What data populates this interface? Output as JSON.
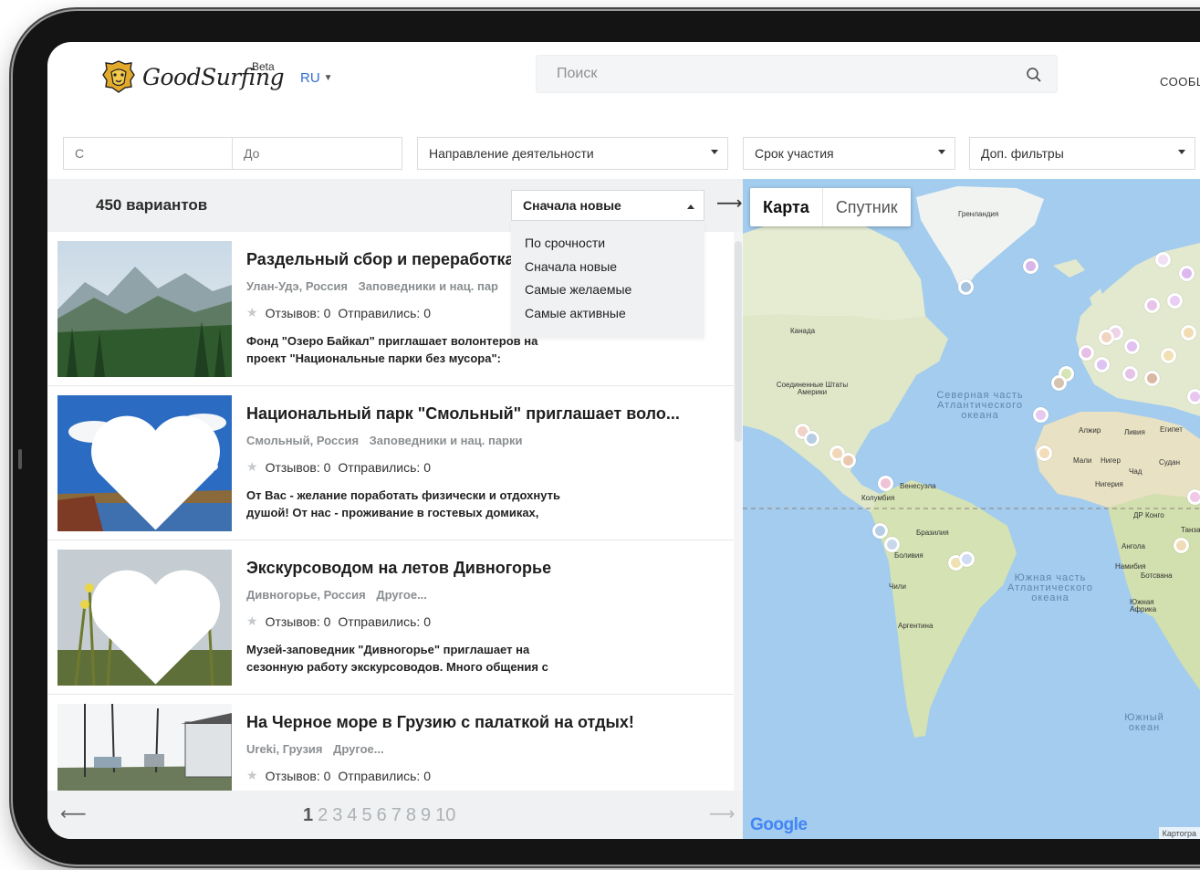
{
  "header": {
    "logo_text": "GoodSurfing",
    "beta_label": "Beta",
    "language": "RU",
    "search_placeholder": "Поиск",
    "nav_messages": "СООБЩ"
  },
  "filters": {
    "from_placeholder": "С",
    "to_placeholder": "До",
    "activity": "Направление деятельности",
    "duration": "Срок участия",
    "extra": "Доп. фильтры"
  },
  "list": {
    "count": "450 вариантов",
    "sort_current": "Сначала новые",
    "collapse_arrow": "⟶",
    "sort_options": [
      "По срочности",
      "Сначала новые",
      "Самые желаемые",
      "Самые активные"
    ],
    "cards": [
      {
        "title": "Раздельный сбор и переработка",
        "place": "Улан-Удэ, Россия",
        "category": "Заповедники и нац. пар",
        "stats": "Отзывов: 0",
        "went": "Отправились: 0",
        "desc": "Фонд \"Озеро Байкал\" приглашает волонтеров на проект \"Национальные парки без мусора\":"
      },
      {
        "title": "Национальный парк \"Смольный\" приглашает воло...",
        "place": "Смольный, Россия",
        "category": "Заповедники и нац. парки",
        "stats": "Отзывов: 0",
        "went": "Отправились: 0",
        "desc": "От Вас - желание поработать физически и отдохнуть душой! От нас - проживание в гостевых домиках,"
      },
      {
        "title": "Экскурсоводом на летов Дивногорье",
        "place": "Дивногорье, Россия",
        "category": "Другое...",
        "stats": "Отзывов: 0",
        "went": "Отправились: 0",
        "desc": "Музей-заповедник \"Дивногорье\" приглашает на сезонную работу экскурсоводов. Много общения с"
      },
      {
        "title": "На Черное море в Грузию с палаткой на отдых!",
        "place": "Ureki, Грузия",
        "category": "Другое...",
        "stats": "Отзывов: 0",
        "went": "Отправились: 0",
        "desc": ""
      }
    ]
  },
  "pager": {
    "prev": "⟵",
    "next": "⟶",
    "pages": [
      "1",
      "2",
      "3",
      "4",
      "5",
      "6",
      "7",
      "8",
      "9",
      "10"
    ],
    "active_page": "1"
  },
  "map": {
    "tab_map": "Карта",
    "tab_satellite": "Спутник",
    "labels": {
      "greenland": "Гренландия",
      "canada": "Канада",
      "usa": "Соединенные Штаты Америки",
      "north_atlantic": "Северная часть Атлантического океана",
      "south_atlantic": "Южная часть Атлантического океана",
      "southern_ocean": "Южный океан",
      "brazil": "Бразилия",
      "bolivia": "Боливия",
      "chile": "Чили",
      "argentina": "Аргентина",
      "colombia": "Колумбия",
      "venezuela": "Венесуэла",
      "algeria": "Алжир",
      "libya": "Ливия",
      "egypt": "Египет",
      "mali": "Мали",
      "niger": "Нигер",
      "chad": "Чад",
      "sudan": "Судан",
      "nigeria": "Нигерия",
      "dr_congo": "ДР Конго",
      "tanzania": "Танзан",
      "angola": "Ангола",
      "namibia": "Намибия",
      "botswana": "Ботсвана",
      "south_africa": "Южная Африка"
    },
    "google": "Google",
    "attribution": "Картогра"
  },
  "colors": {
    "accent": "#2f6fd6",
    "water": "#a3ccee",
    "land": "#dfe7c8",
    "panel": "#eff1f2"
  }
}
